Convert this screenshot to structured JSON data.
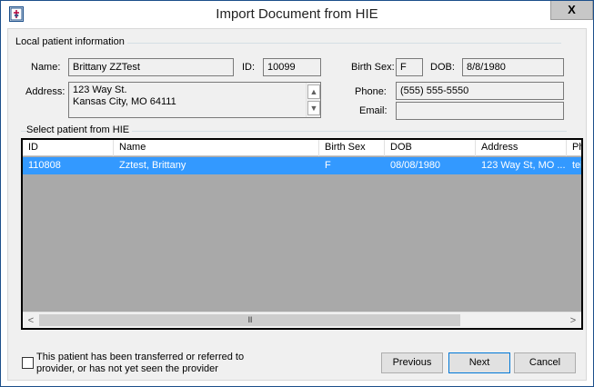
{
  "window": {
    "title": "Import Document from HIE",
    "close_label": "X"
  },
  "local_info": {
    "group_label": "Local patient information",
    "name_label": "Name:",
    "name_value": "Brittany ZZTest",
    "id_label": "ID:",
    "id_value": "10099",
    "birth_sex_label": "Birth Sex:",
    "birth_sex_value": "F",
    "dob_label": "DOB:",
    "dob_value": "8/8/1980",
    "address_label": "Address:",
    "address_value": "123 Way St.\nKansas City, MO 64111",
    "phone_label": "Phone:",
    "phone_value": "(555) 555-5550",
    "email_label": "Email:",
    "email_value": ""
  },
  "hie": {
    "group_label": "Select patient from HIE",
    "columns": [
      "ID",
      "Name",
      "Birth Sex",
      "DOB",
      "Address",
      "Ph"
    ],
    "rows": [
      [
        "110808",
        "Zztest, Brittany",
        "F",
        "08/08/1980",
        "123 Way St, MO ...",
        "tel:"
      ]
    ],
    "scroll_left": "<",
    "scroll_right": ">",
    "scroll_thumb_grip": "III"
  },
  "footer": {
    "checkbox_label": "This patient has been transferred or referred to provider, or has not yet seen the provider",
    "checkbox_checked": false,
    "previous_label": "Previous",
    "next_label": "Next",
    "cancel_label": "Cancel"
  },
  "colors": {
    "selection": "#3399ff",
    "grid_background": "#a9a9a9",
    "window_border": "#1c4f8a"
  }
}
